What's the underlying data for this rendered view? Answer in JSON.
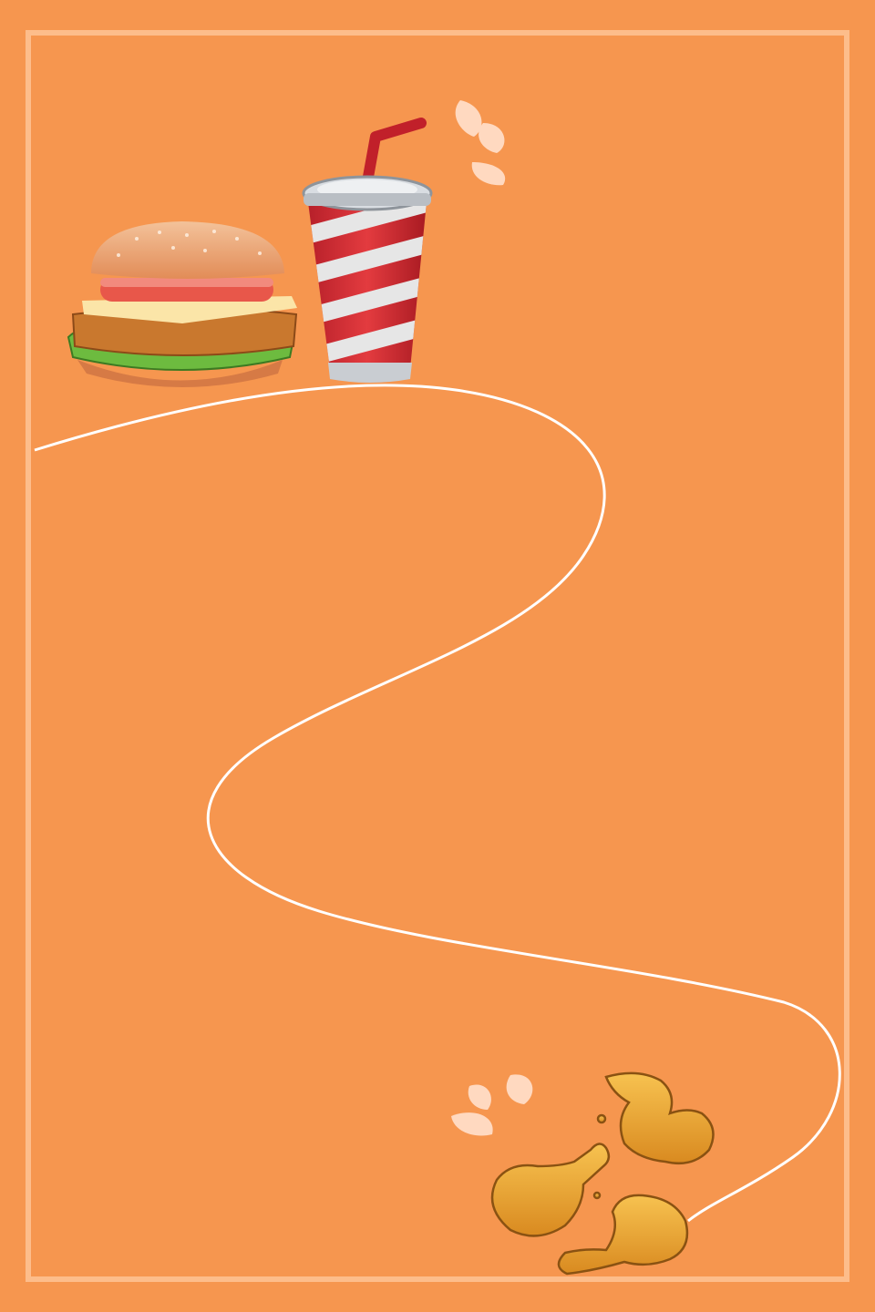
{
  "poster": {
    "background_color": "#F6964F",
    "frame_color": "#FFC79A",
    "path_color": "#FFFFFF",
    "accent_drop_color": "#FFD9C0",
    "items": [
      {
        "icon": "hamburger-icon"
      },
      {
        "icon": "soda-cup-icon"
      },
      {
        "icon": "fried-chicken-icon"
      }
    ]
  }
}
